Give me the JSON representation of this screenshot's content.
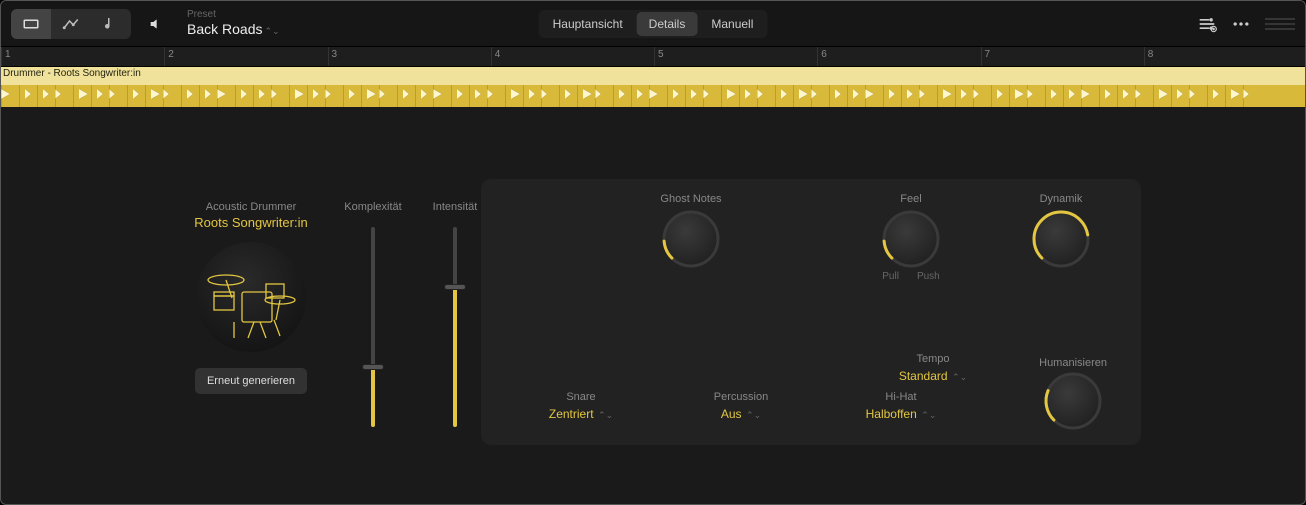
{
  "toolbar": {
    "preset_label": "Preset",
    "preset_name": "Back Roads",
    "view_tabs": [
      "Hauptansicht",
      "Details",
      "Manuell"
    ],
    "active_tab": 1
  },
  "ruler": {
    "bars": [
      1,
      2,
      3,
      4,
      5,
      6,
      7,
      8
    ]
  },
  "region": {
    "name": "Drummer - Roots Songwriter:in"
  },
  "drummer": {
    "category": "Acoustic Drummer",
    "name": "Roots Songwriter:in",
    "regenerate": "Erneut generieren"
  },
  "sliders": {
    "complexity": {
      "label": "Komplexität",
      "value": 0.3
    },
    "intensity": {
      "label": "Intensität",
      "value": 0.7
    }
  },
  "knobs": {
    "ghost": {
      "label": "Ghost Notes",
      "value": 0.15
    },
    "feel": {
      "label": "Feel",
      "value": 0.15,
      "sublabels": [
        "Pull",
        "Push"
      ]
    },
    "dynamics": {
      "label": "Dynamik",
      "value": 0.8
    },
    "humanize": {
      "label": "Humanisieren",
      "value": 0.25
    }
  },
  "dropdowns": {
    "snare": {
      "label": "Snare",
      "value": "Zentriert"
    },
    "percussion": {
      "label": "Percussion",
      "value": "Aus"
    },
    "hihat": {
      "label": "Hi-Hat",
      "value": "Halboffen"
    },
    "tempo": {
      "label": "Tempo",
      "value": "Standard"
    }
  }
}
